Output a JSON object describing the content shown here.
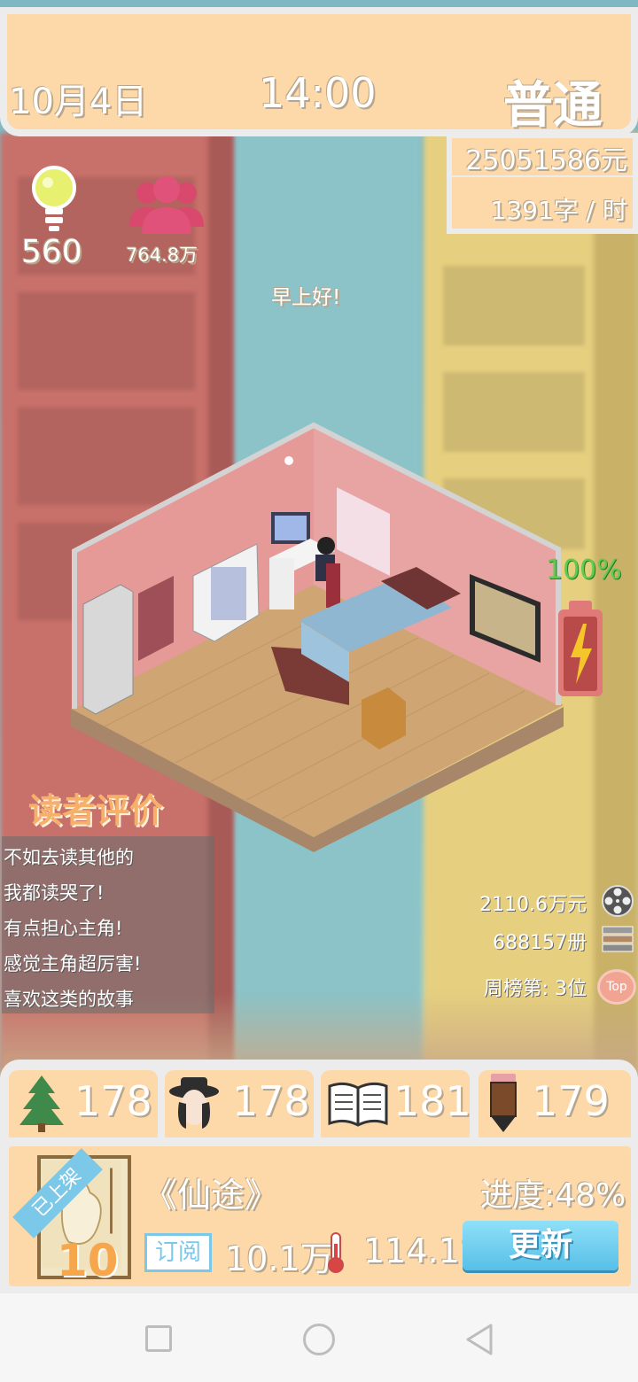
{
  "hud": {
    "date": "10月4日",
    "time": "14:00",
    "difficulty": "普通",
    "money": "25051586元",
    "writing_speed": "1391字 / 时"
  },
  "stats": {
    "ideas": "560",
    "fans": "764.8万",
    "bulb_icon": "lightbulb-icon",
    "fans_icon": "people-icon"
  },
  "greeting": "早上好!",
  "battery": {
    "percent_text": "100%",
    "level": 1.0,
    "color": "#5fcc4f"
  },
  "reviews": {
    "title": "读者评价",
    "items": [
      "不如去读其他的",
      "我都读哭了!",
      "有点担心主角!",
      "感觉主角超厉害!",
      "喜欢这类的故事"
    ]
  },
  "sales": {
    "revenue": "2110.6万元",
    "copies": "688157册",
    "rank": "周榜第: 3位",
    "top_label": "Top"
  },
  "attributes": [
    {
      "icon": "tree-icon",
      "value": "178"
    },
    {
      "icon": "character-icon",
      "value": "178"
    },
    {
      "icon": "book-icon",
      "value": "181"
    },
    {
      "icon": "pencil-icon",
      "value": "179"
    }
  ],
  "book": {
    "shelved_badge": "已上架",
    "cover_number": "10",
    "title": "《仙途》",
    "progress": "进度:48%",
    "subscribe_label": "订阅",
    "subscribers": "10.1万",
    "heat": "114.1°",
    "update_button": "更新"
  },
  "colors": {
    "panel": "#fdd9a9",
    "accent_blue": "#7cc8e8",
    "battery_green": "#5fcc4f"
  }
}
